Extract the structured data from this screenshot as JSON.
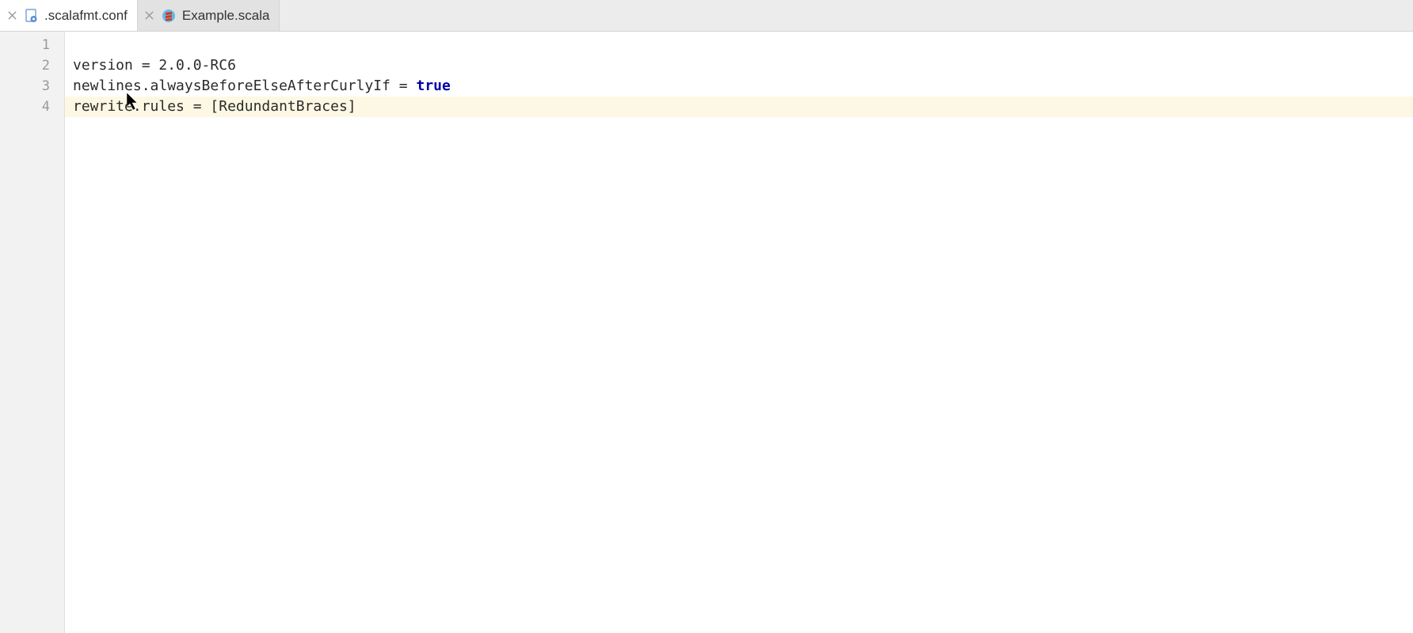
{
  "tabs": [
    {
      "filename": ".scalafmt.conf",
      "active": true,
      "iconType": "conf"
    },
    {
      "filename": "Example.scala",
      "active": false,
      "iconType": "scala"
    }
  ],
  "gutter": {
    "lines": [
      "1",
      "2",
      "3",
      "4"
    ]
  },
  "code": {
    "line1_blank": "",
    "line2_a": "version = 2.0.0-RC6",
    "line3_a": "newlines.alwaysBeforeElseAfterCurlyIf = ",
    "line3_kw": "true",
    "line4_a": "rewrite.rules = [RedundantBraces]"
  },
  "colors": {
    "highlightBg": "#fcf8e3",
    "keyword": "#0000aa",
    "gutterBg": "#f2f2f2"
  }
}
